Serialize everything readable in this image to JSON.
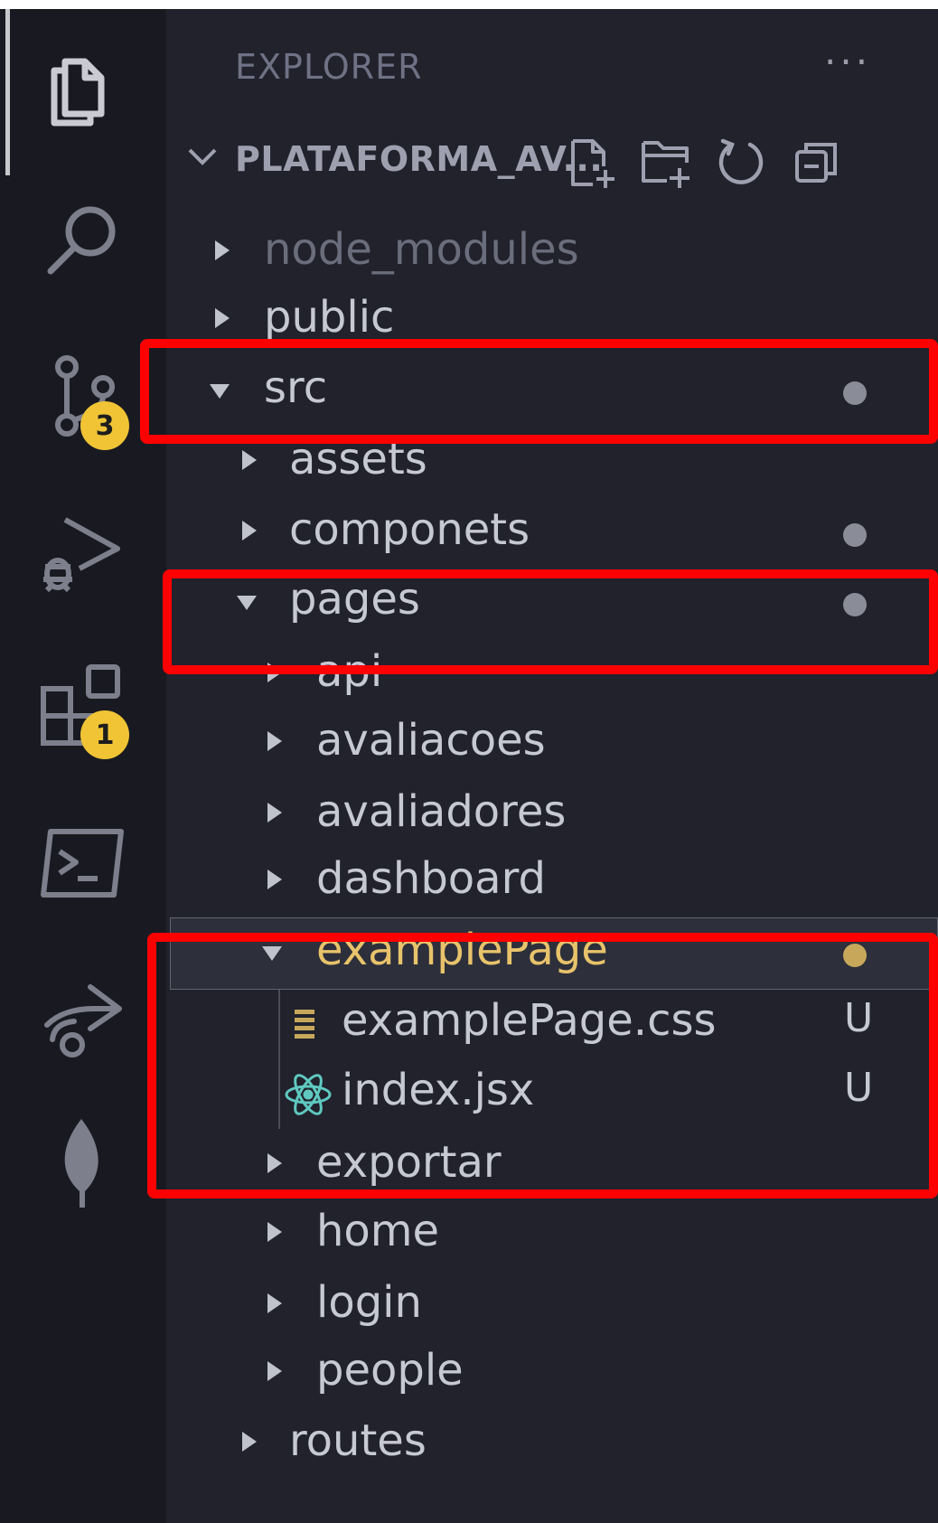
{
  "activity_bar": {
    "items": [
      {
        "name": "explorer-icon",
        "active": true
      },
      {
        "name": "search-icon"
      },
      {
        "name": "source-control-icon",
        "badge": "3"
      },
      {
        "name": "run-debug-icon"
      },
      {
        "name": "extensions-icon",
        "badge": "1"
      },
      {
        "name": "terminal-icon"
      },
      {
        "name": "live-share-icon"
      },
      {
        "name": "mongodb-leaf-icon"
      }
    ]
  },
  "sidebar": {
    "title": "EXPLORER",
    "more_label": "···",
    "project": {
      "name": "PLATAFORMA_AV...",
      "tools": [
        "new-file-icon",
        "new-folder-icon",
        "refresh-icon",
        "collapse-all-icon"
      ]
    },
    "tree": [
      {
        "label": "node_modules",
        "type": "folder",
        "expanded": false,
        "dimmed": true
      },
      {
        "label": "public",
        "type": "folder",
        "expanded": false
      },
      {
        "label": "src",
        "type": "folder",
        "expanded": true,
        "modified": true
      },
      {
        "label": "assets",
        "type": "folder",
        "expanded": false
      },
      {
        "label": "componets",
        "type": "folder",
        "expanded": false,
        "modified": true
      },
      {
        "label": "pages",
        "type": "folder",
        "expanded": true,
        "modified": true
      },
      {
        "label": "api",
        "type": "folder",
        "expanded": false
      },
      {
        "label": "avaliacoes",
        "type": "folder",
        "expanded": false
      },
      {
        "label": "avaliadores",
        "type": "folder",
        "expanded": false
      },
      {
        "label": "dashboard",
        "type": "folder",
        "expanded": false
      },
      {
        "label": "examplePage",
        "type": "folder",
        "expanded": true,
        "modified": true,
        "selected": true
      },
      {
        "label": "examplePage.css",
        "type": "css",
        "status": "U"
      },
      {
        "label": "index.jsx",
        "type": "jsx",
        "status": "U"
      },
      {
        "label": "exportar",
        "type": "folder",
        "expanded": false
      },
      {
        "label": "home",
        "type": "folder",
        "expanded": false
      },
      {
        "label": "login",
        "type": "folder",
        "expanded": false
      },
      {
        "label": "people",
        "type": "folder",
        "expanded": false
      },
      {
        "label": "routes",
        "type": "folder",
        "expanded": false
      }
    ]
  },
  "colors": {
    "highlight_box": "#ff0000",
    "badge": "#f0c435",
    "modified_folder_text": "#e8c36b"
  }
}
